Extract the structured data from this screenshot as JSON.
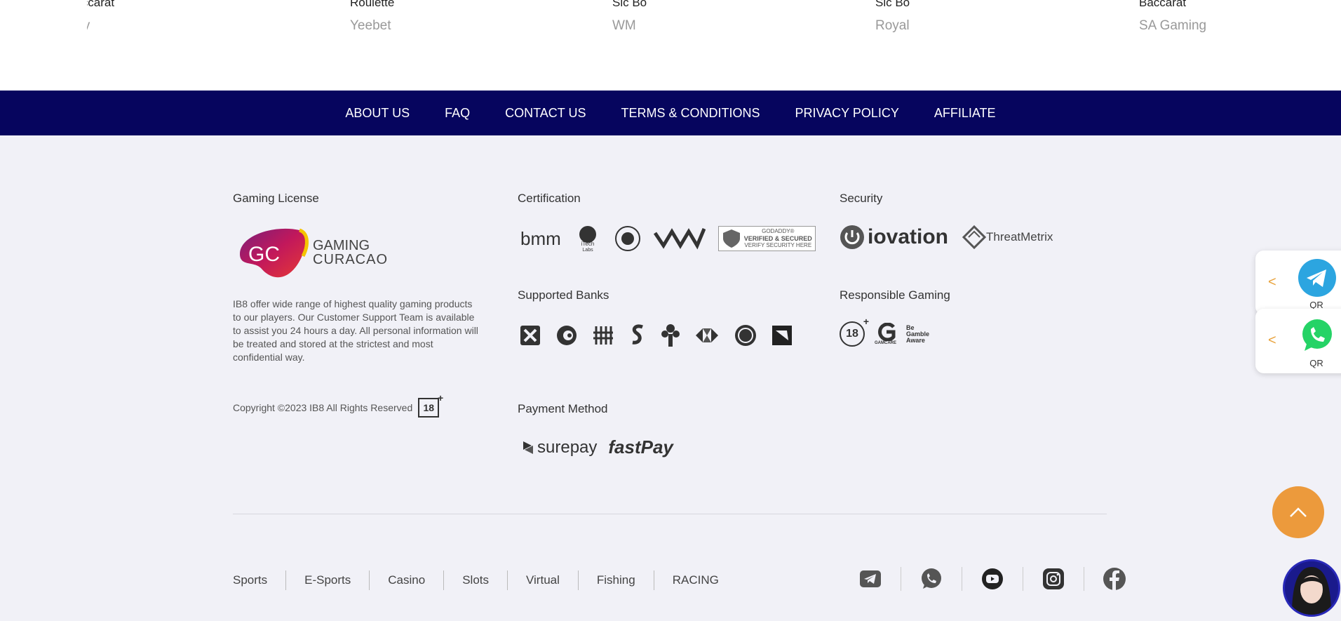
{
  "games": [
    {
      "name": "Baccarat",
      "provider": "Sexy"
    },
    {
      "name": "Roulette",
      "provider": "Yeebet"
    },
    {
      "name": "Sic Bo",
      "provider": "WM"
    },
    {
      "name": "Sic Bo",
      "provider": "Royal"
    },
    {
      "name": "Baccarat",
      "provider": "SA Gaming"
    }
  ],
  "nav": [
    "ABOUT US",
    "FAQ",
    "CONTACT US",
    "TERMS & CONDITIONS",
    "PRIVACY POLICY",
    "AFFILIATE"
  ],
  "license": {
    "title": "Gaming License",
    "logo_mark": "GC",
    "logo_line1": "GAMING",
    "logo_line2": "CURACAO",
    "description": "IB8 offer wide range of highest quality gaming products to our players. Our Customer Support Team is available to assist you 24 hours a day. All personal information will be treated and stored at the strictest and most confidential way.",
    "copyright": "Copyright ©2023 IB8 All Rights Reserved",
    "age_badge": "18"
  },
  "certification": {
    "title": "Certification",
    "bmm": "bmm",
    "itech": "iTech Labs",
    "godaddy_line1": "GODADDY®",
    "godaddy_line2": "VERIFIED & SECURED",
    "godaddy_line3": "VERIFY SECURITY HERE"
  },
  "security": {
    "title": "Security",
    "iovation": "iovation",
    "threatmetrix": "ThreatMetrix"
  },
  "banks": {
    "title": "Supported Banks",
    "icons": [
      "bank-x-icon",
      "bank-swirl-icon",
      "bank-bars-icon",
      "bank-s-icon",
      "bank-key-icon",
      "bank-hsbc-icon",
      "bank-seal-icon",
      "bank-flag-icon"
    ]
  },
  "responsible": {
    "title": "Responsible Gaming",
    "age": "18",
    "gamcare": "GAMCARE",
    "gamble_aware": "Be Gamble Aware"
  },
  "payment": {
    "title": "Payment Method",
    "surepay": "surepay",
    "fastpay": "fastPay"
  },
  "bottom_nav": [
    "Sports",
    "E-Sports",
    "Casino",
    "Slots",
    "Virtual",
    "Fishing",
    "RACING"
  ],
  "social": [
    "telegram-icon",
    "whatsapp-icon",
    "youtube-icon",
    "instagram-icon",
    "facebook-icon"
  ],
  "float": {
    "qr_label": "QR"
  },
  "colors": {
    "nav_bg": "#06055e",
    "accent": "#ec9a3c",
    "telegram": "#2ca5e0",
    "whatsapp": "#25d366"
  }
}
